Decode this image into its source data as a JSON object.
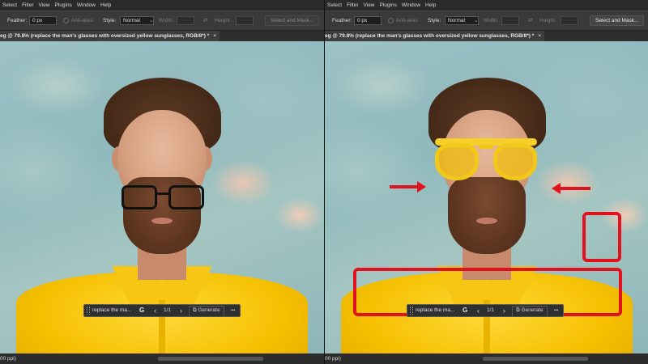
{
  "menu": [
    "Select",
    "Filter",
    "View",
    "Plugins",
    "Window",
    "Help"
  ],
  "options": {
    "feather_label": "Feather:",
    "feather_value": "0 px",
    "antialias_label": "Anti-alias",
    "style_label": "Style:",
    "style_value": "Normal",
    "width_label": "Width:",
    "height_label": "Height:",
    "select_mask_label": "Select and Mask..."
  },
  "tab": {
    "title": "eg @ 79.8% (replace the man's glasses with oversized yellow sunglasses, RGB/8*) *",
    "close": "×"
  },
  "generative_bar": {
    "prompt_text": "replace the ma...",
    "g_icon": "G",
    "prev": "‹",
    "count": "1/1",
    "next": "›",
    "generate_label": "Generate",
    "more": "•••"
  },
  "status": {
    "zoom_text": "00 ppi)"
  },
  "colors": {
    "highlight_red": "#e1121e",
    "ui_dark": "#3a3a3a"
  }
}
